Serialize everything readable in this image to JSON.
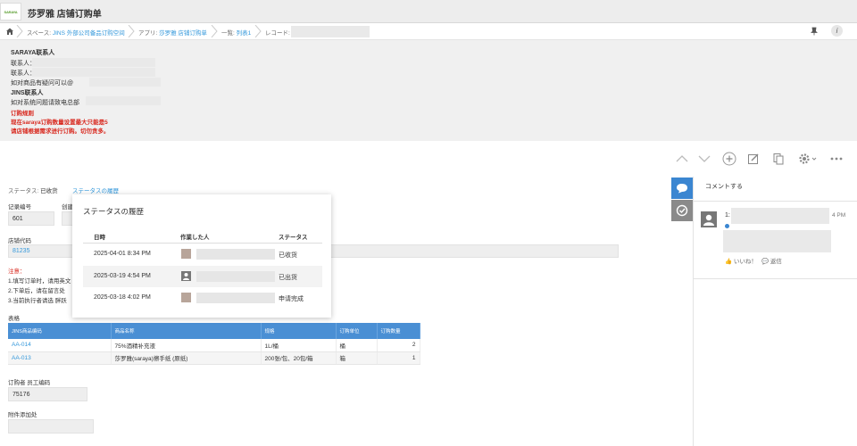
{
  "header": {
    "logo_text": "SARAYA",
    "title": "莎罗雅 店铺订购单"
  },
  "breadcrumb": {
    "space_prefix": "スペース: ",
    "space_name": "JINS 外部公司备品订购空间",
    "app_prefix": "アプリ: ",
    "app_name": "莎罗雅 店铺订购单",
    "list_prefix": "一覧: ",
    "list_name": "列表1",
    "record_prefix": "レコード: "
  },
  "info": {
    "saraya_contact": "SARAYA联系人",
    "contact_1": "联系人：",
    "contact_2": "联系人：",
    "product_question": "如对商品有疑问可以@",
    "jins_contact": "JINS联系人",
    "system_question": "如对系统问题请致电总部",
    "order_rule_title": "订购规则",
    "order_rule_1": "现在saraya订购数量设置最大只能是5",
    "order_rule_2": "请店铺根据需求进行订购。切勿贪多。"
  },
  "status": {
    "label": "ステータス: ",
    "value": "已收货",
    "history_link": "ステータスの履歴"
  },
  "fields": {
    "record_no_label": "记录编号",
    "record_no_value": "601",
    "creator_label": "创建",
    "store_code_label": "店铺代码",
    "store_code_value": "81235",
    "notes_title": "注意：",
    "note_1": "1.填写订单时，请用英文",
    "note_2": "2.下单后，请在留言处",
    "note_3": "3.当前执行者请选 胖跃",
    "table_label": "表格",
    "orderer_label": "订购者 员工编码",
    "orderer_value": "75176",
    "attachment_label": "附件添加处"
  },
  "table": {
    "headers": [
      "JINS商品编码",
      "商品名称",
      "规格",
      "订购单位",
      "订购数量"
    ],
    "rows": [
      [
        "AA-014",
        "75%酒精补充液",
        "1L/桶",
        "桶",
        "2"
      ],
      [
        "AA-013",
        "莎罗雅(saraya)擦手纸 (原纸)",
        "200张/包、20包/箱",
        "箱",
        "1"
      ]
    ]
  },
  "history_popup": {
    "title": "ステータスの履歴",
    "col_date": "日時",
    "col_user": "作業した人",
    "col_status": "ステータス",
    "rows": [
      {
        "date": "2025-04-01 8:34 PM",
        "status": "已收货"
      },
      {
        "date": "2025-03-19 4:54 PM",
        "status": "已出货"
      },
      {
        "date": "2025-03-18 4:02 PM",
        "status": "申请完成"
      }
    ]
  },
  "sidebar": {
    "comment_prompt": "コメントする",
    "comment_index": "1:",
    "comment_time_tail": "4 PM",
    "like": "いいね！",
    "reply": "返信"
  },
  "colors": {
    "accent": "#4a8fd4",
    "link": "#3498db",
    "warning": "#d8281e",
    "tab": "#3b86d1",
    "tab_inactive": "#8a8a8a"
  }
}
